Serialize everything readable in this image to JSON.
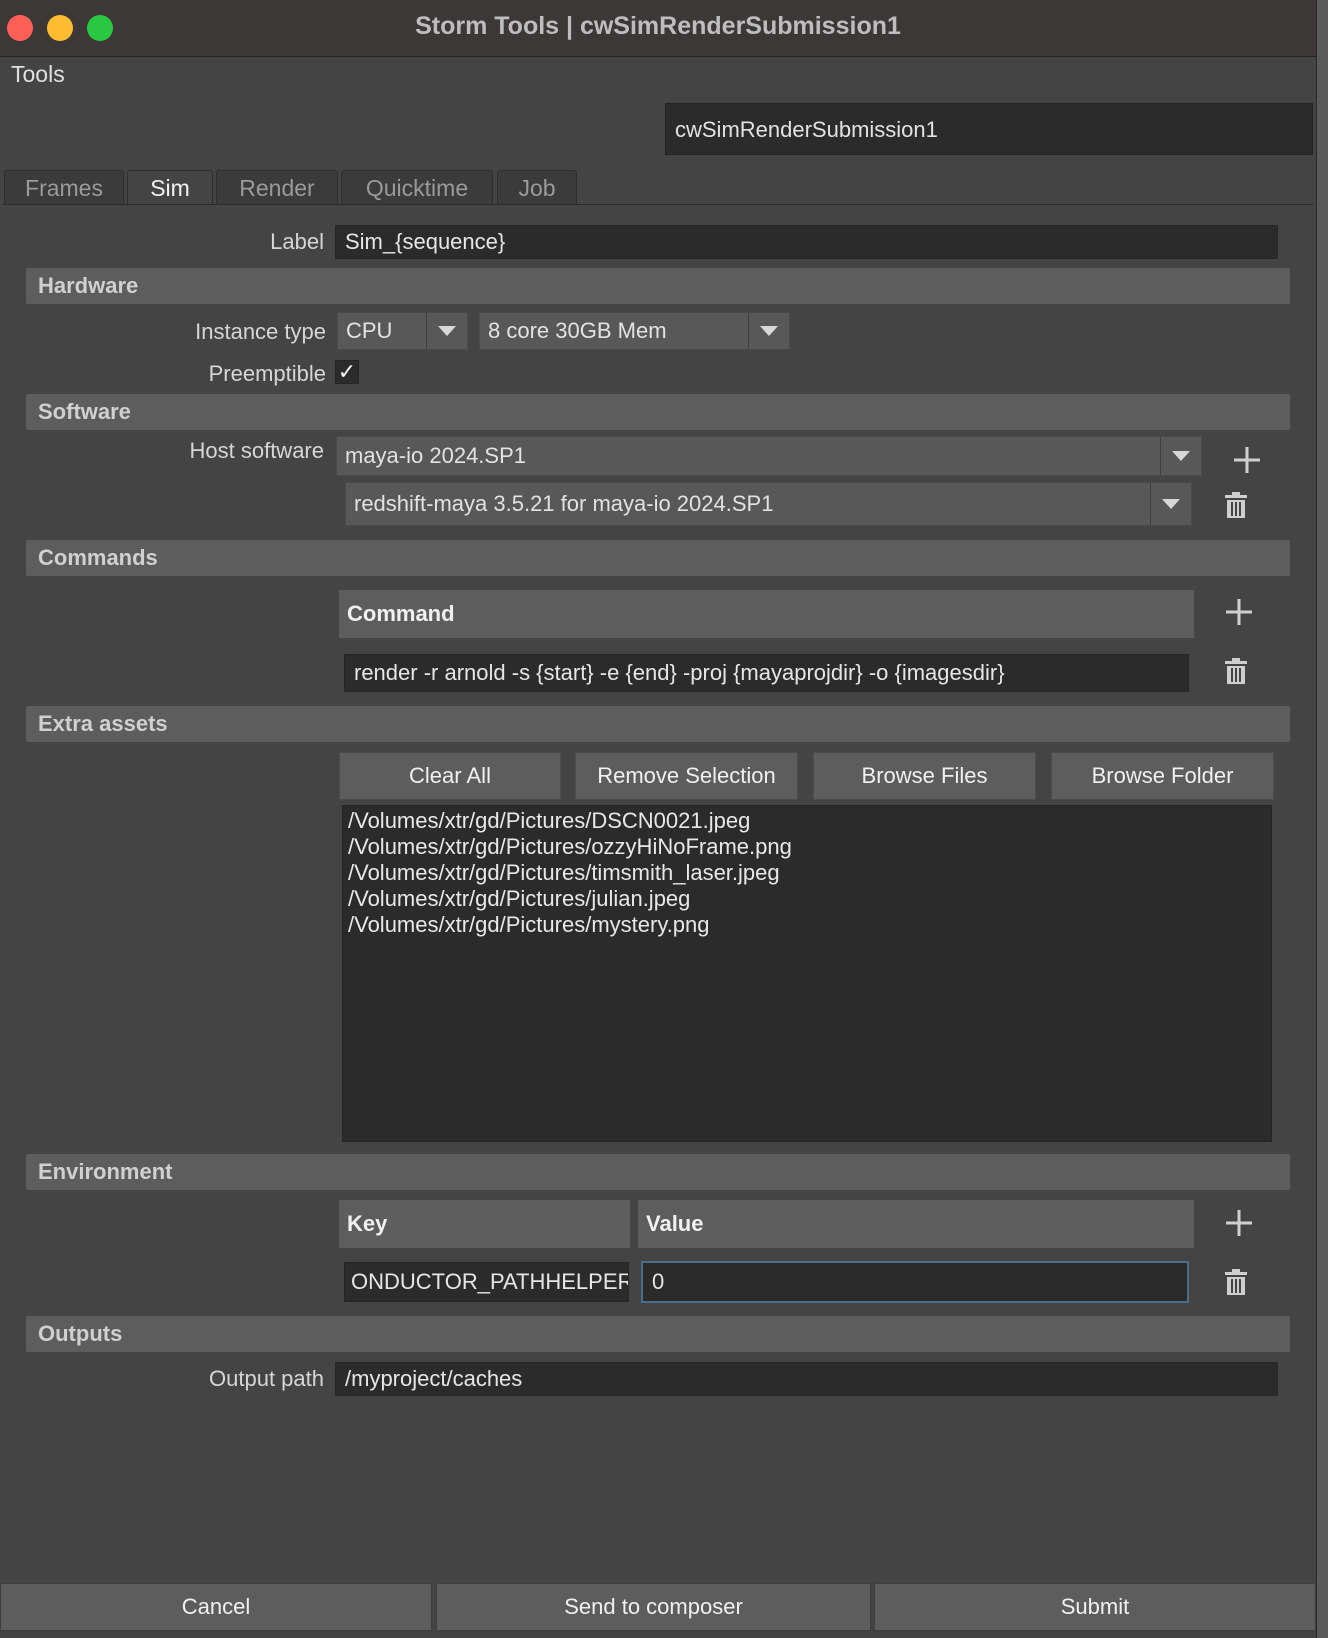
{
  "window": {
    "title": "Storm Tools | cwSimRenderSubmission1"
  },
  "menu": {
    "tools": "Tools"
  },
  "node_name": "cwSimRenderSubmission1",
  "tabs": [
    "Frames",
    "Sim",
    "Render",
    "Quicktime",
    "Job"
  ],
  "active_tab": "Sim",
  "label_field": {
    "label": "Label",
    "value": "Sim_{sequence}"
  },
  "hardware": {
    "title": "Hardware",
    "instance_type_label": "Instance type",
    "instance_type": "CPU",
    "machine": "8 core 30GB Mem",
    "preemptible_label": "Preemptible",
    "preemptible_checked": true,
    "check_glyph": "✓"
  },
  "software": {
    "title": "Software",
    "host_label": "Host software",
    "host": "maya-io 2024.SP1",
    "plugin": "redshift-maya 3.5.21 for maya-io 2024.SP1"
  },
  "commands": {
    "title": "Commands",
    "header": "Command",
    "command": "render -r arnold -s {start} -e {end} -proj {mayaprojdir} -o {imagesdir}"
  },
  "extra_assets": {
    "title": "Extra assets",
    "buttons": {
      "clear_all": "Clear All",
      "remove_selection": "Remove Selection",
      "browse_files": "Browse Files",
      "browse_folder": "Browse Folder"
    },
    "files": [
      "/Volumes/xtr/gd/Pictures/DSCN0021.jpeg",
      "/Volumes/xtr/gd/Pictures/ozzyHiNoFrame.png",
      "/Volumes/xtr/gd/Pictures/timsmith_laser.jpeg",
      "/Volumes/xtr/gd/Pictures/julian.jpeg",
      "/Volumes/xtr/gd/Pictures/mystery.png"
    ]
  },
  "environment": {
    "title": "Environment",
    "key_header": "Key",
    "value_header": "Value",
    "key": "ONDUCTOR_PATHHELPER",
    "value": "0"
  },
  "outputs": {
    "title": "Outputs",
    "path_label": "Output path",
    "path": "/myproject/caches"
  },
  "footer": {
    "cancel": "Cancel",
    "send": "Send to composer",
    "submit": "Submit"
  },
  "colors": {
    "window_bg": "#444444",
    "section_bg": "#5d5d5d",
    "field_bg": "#2b2b2b",
    "focus": "#4a6d8c"
  }
}
